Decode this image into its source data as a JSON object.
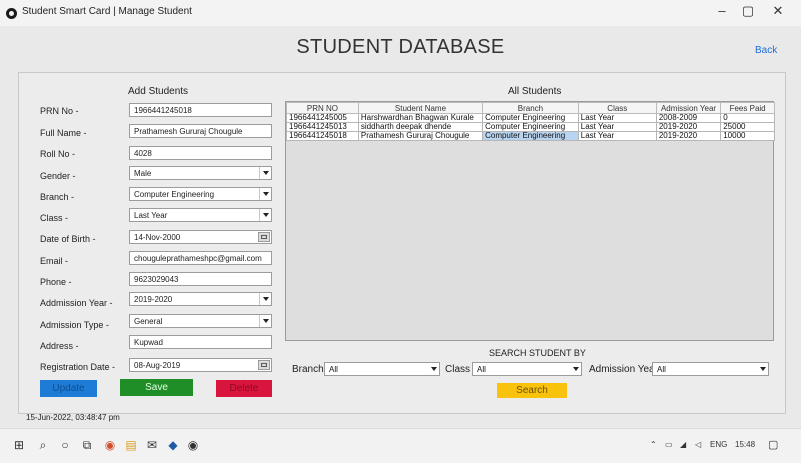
{
  "window": {
    "title": "Student Smart Card | Manage Student",
    "controls": [
      "–",
      "▢",
      "✕"
    ]
  },
  "header": {
    "title": "STUDENT DATABASE",
    "back_label": "Back"
  },
  "add_form": {
    "section_title": "Add Students",
    "fields": [
      {
        "label": "PRN No -",
        "value": "1966441245018"
      },
      {
        "label": "Full Name -",
        "value": "Prathamesh Gururaj Chougule"
      },
      {
        "label": "Roll No -",
        "value": "4028"
      },
      {
        "label": "Gender -",
        "value": "Male"
      },
      {
        "label": "Branch -",
        "value": "Computer Engineering"
      },
      {
        "label": "Class -",
        "value": "Last Year"
      },
      {
        "label": "Date of Birth -",
        "value": "14-Nov-2000"
      },
      {
        "label": "Email -",
        "value": "chouguleprathameshpc@gmail.com"
      },
      {
        "label": "Phone -",
        "value": "9623029043"
      },
      {
        "label": "Addmission Year -",
        "value": "2019-2020"
      },
      {
        "label": "Admission Type -",
        "value": "General"
      },
      {
        "label": "Address -",
        "value": "Kupwad"
      },
      {
        "label": "Registration Date -",
        "value": "08-Aug-2019"
      }
    ],
    "buttons": {
      "update": "Update",
      "save": "Save",
      "delete": "Delete"
    }
  },
  "all_students": {
    "section_title": "All Students",
    "columns": [
      "PRN NO",
      "Student Name",
      "Branch",
      "Class",
      "Admission Year",
      "Fees Paid"
    ],
    "rows": [
      [
        "1966441245005",
        "Harshwardhan Bhagwan Kurale",
        "Computer Engineering",
        "Last Year",
        "2008-2009",
        "0"
      ],
      [
        "1966441245013",
        "siddharth deepak dhende",
        "Computer Engineering",
        "Last Year",
        "2019-2020",
        "25000"
      ],
      [
        "1966441245018",
        "Prathamesh Gururaj Chougule",
        "Computer Engineering",
        "Last Year",
        "2019-2020",
        "10000"
      ]
    ]
  },
  "search": {
    "title": "SEARCH STUDENT BY",
    "branch_label": "Branch",
    "branch_value": "All",
    "class_label": "Class",
    "class_value": "All",
    "year_label": "Admission Year",
    "year_value": "All",
    "button": "Search"
  },
  "status": {
    "timestamp": "15-Jun-2022, 03:48:47 pm"
  },
  "taskbar": {
    "language": "ENG",
    "time": "15:48"
  },
  "colors": {
    "update": "#1e7cd6",
    "save": "#1f8e26",
    "delete": "#d9143d",
    "search": "#f9c20d",
    "back_link": "#1d6fd6"
  }
}
